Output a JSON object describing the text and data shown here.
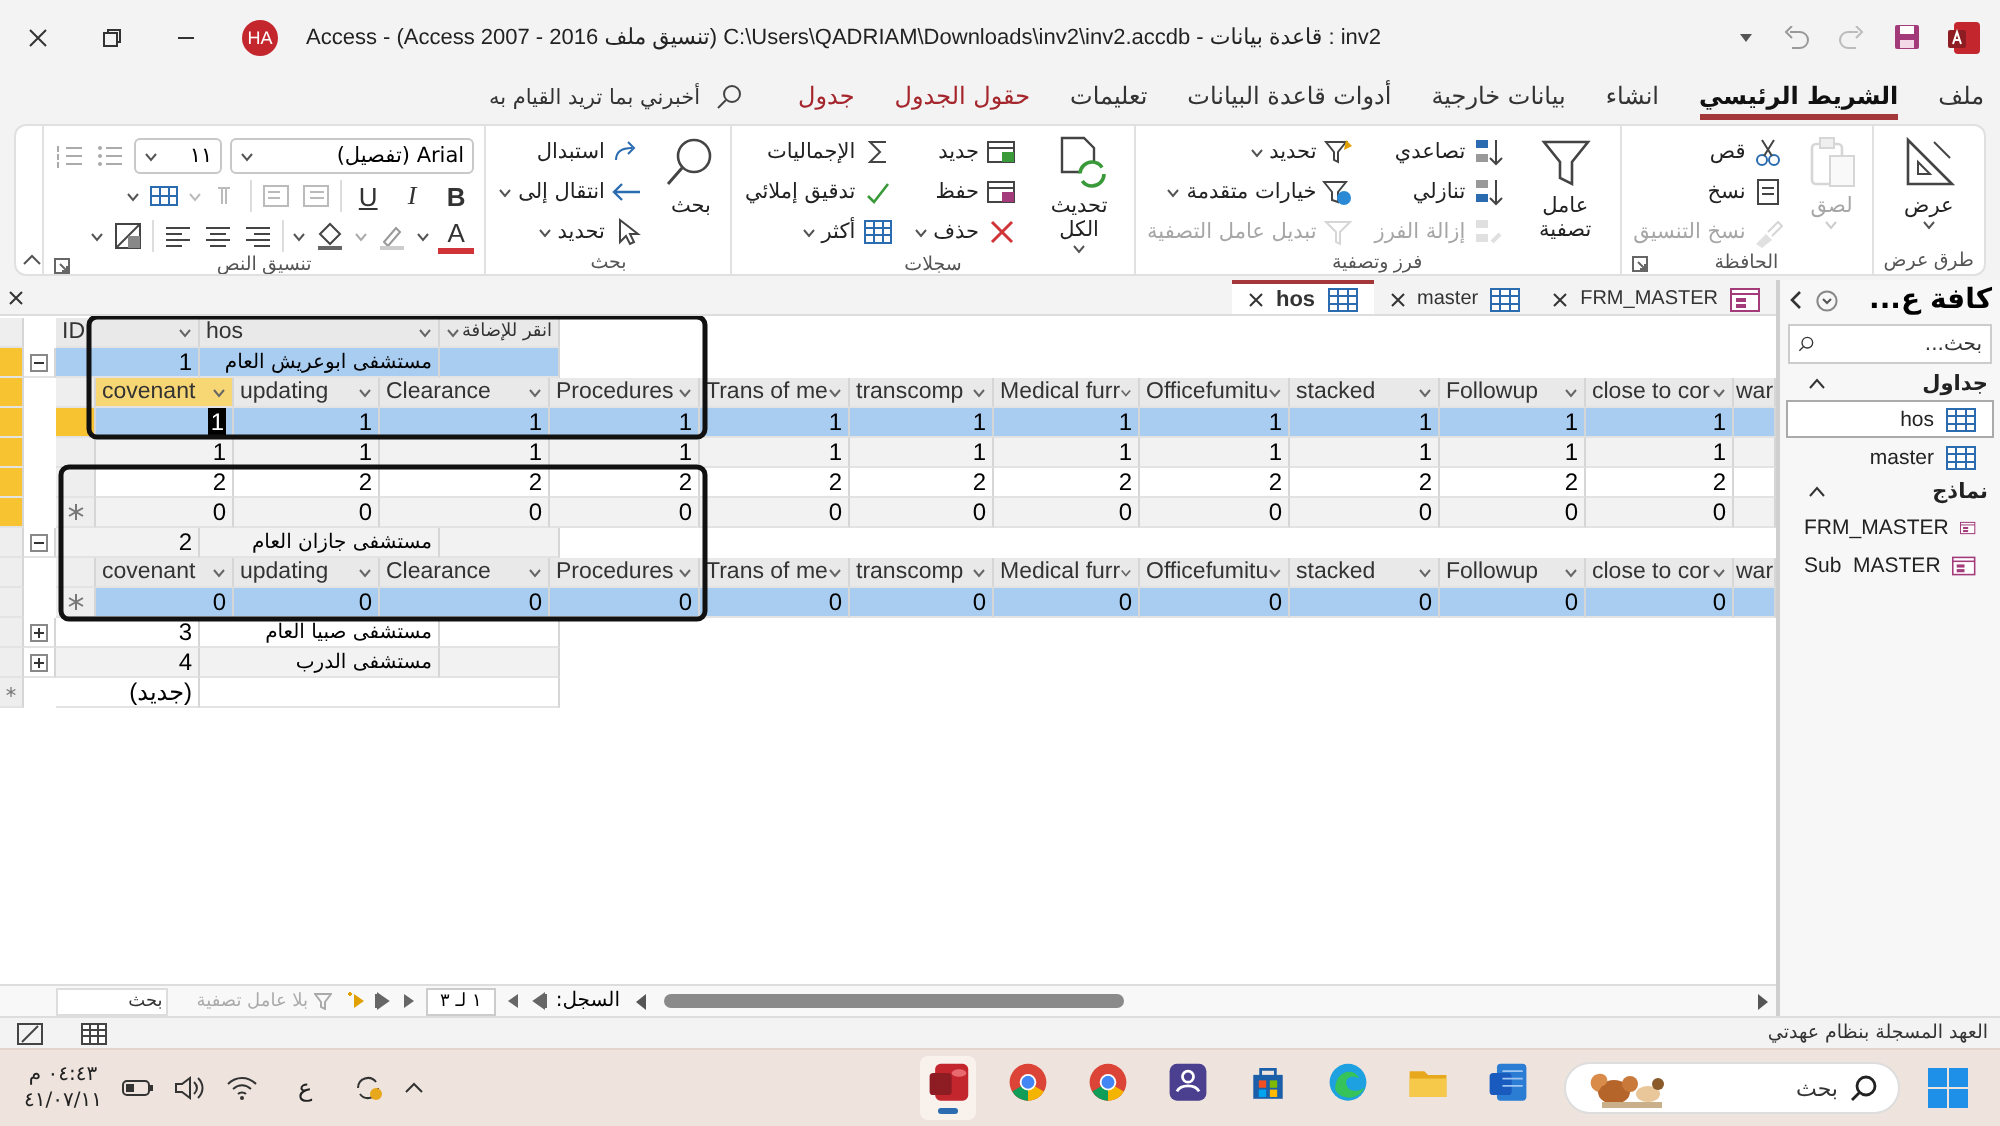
{
  "title_bar": {
    "title": "Access  -  (Access 2007 - 2016 تنسيق ملف) C:\\Users\\QADRIAM\\Downloads\\inv2\\inv2.accdb - قاعدة بيانات : inv2",
    "account": "HA"
  },
  "ribbon_tabs": [
    {
      "label": "ملف",
      "selected": false,
      "contextual": false
    },
    {
      "label": "الشريط الرئيسي",
      "selected": true,
      "contextual": false
    },
    {
      "label": "انشاء",
      "selected": false,
      "contextual": false
    },
    {
      "label": "بيانات خارجية",
      "selected": false,
      "contextual": false
    },
    {
      "label": "أدوات قاعدة البيانات",
      "selected": false,
      "contextual": false
    },
    {
      "label": "تعليمات",
      "selected": false,
      "contextual": false
    },
    {
      "label": "حقول الجدول",
      "selected": false,
      "contextual": true
    },
    {
      "label": "جدول",
      "selected": false,
      "contextual": true
    }
  ],
  "tell_me": {
    "placeholder": "أخبرني بما تريد القيام به"
  },
  "ribbon_groups": [
    {
      "kind": "commands",
      "label": "طرق عرض",
      "launcher": false,
      "items": [
        {
          "kind": "large",
          "label": "عرض",
          "disabled": false,
          "dropdown": true
        }
      ]
    },
    {
      "kind": "commands",
      "label": "الحافظة",
      "launcher": true,
      "items": [
        {
          "kind": "large",
          "label": "لصق",
          "disabled": true,
          "dropdown": true
        },
        {
          "kind": "column",
          "buttons": [
            {
              "label": "قص",
              "disabled": false,
              "dropdown": false
            },
            {
              "label": "نسخ",
              "disabled": false,
              "dropdown": false
            },
            {
              "label": "نسخ التنسيق",
              "disabled": true,
              "dropdown": false
            }
          ]
        }
      ]
    },
    {
      "kind": "commands",
      "label": "فرز وتصفية",
      "launcher": false,
      "items": [
        {
          "kind": "large",
          "label": "عامل تصفية",
          "disabled": false,
          "dropdown": false
        },
        {
          "kind": "column",
          "buttons": [
            {
              "label": "تصاعدي",
              "disabled": false,
              "dropdown": false
            },
            {
              "label": "تنازلي",
              "disabled": false,
              "dropdown": false
            },
            {
              "label": "إزالة الفرز",
              "disabled": true,
              "dropdown": false
            }
          ]
        },
        {
          "kind": "column",
          "buttons": [
            {
              "label": "تحديد",
              "disabled": false,
              "dropdown": true
            },
            {
              "label": "خيارات متقدمة",
              "disabled": false,
              "dropdown": true
            },
            {
              "label": "تبديل عامل التصفية",
              "disabled": true,
              "dropdown": false
            }
          ]
        }
      ]
    },
    {
      "kind": "commands",
      "label": "سجلات",
      "launcher": false,
      "items": [
        {
          "kind": "large",
          "label": "تحديث الكل",
          "disabled": false,
          "dropdown": true
        },
        {
          "kind": "column",
          "buttons": [
            {
              "label": "جديد",
              "disabled": false,
              "dropdown": false
            },
            {
              "label": "حفظ",
              "disabled": false,
              "dropdown": false
            },
            {
              "label": "حذف",
              "disabled": false,
              "dropdown": true
            }
          ]
        },
        {
          "kind": "column",
          "buttons": [
            {
              "label": "الإجماليات",
              "disabled": false,
              "dropdown": false
            },
            {
              "label": "تدقيق إملائي",
              "disabled": false,
              "dropdown": false
            },
            {
              "label": "أكثر",
              "disabled": false,
              "dropdown": true
            }
          ]
        }
      ]
    },
    {
      "kind": "commands",
      "label": "بحث",
      "launcher": false,
      "items": [
        {
          "kind": "large",
          "label": "بحث",
          "disabled": false,
          "dropdown": false
        },
        {
          "kind": "column",
          "buttons": [
            {
              "label": "استبدال",
              "disabled": false,
              "dropdown": false
            },
            {
              "label": "انتقال إلى",
              "disabled": false,
              "dropdown": true
            },
            {
              "label": "تحديد",
              "disabled": false,
              "dropdown": true
            }
          ]
        }
      ]
    },
    {
      "kind": "text_format",
      "label": "تنسيق النص",
      "launcher": true,
      "font": "Arial (تفصيل)",
      "size": "١١",
      "bold": "B",
      "italic": "I",
      "underline": "U",
      "font_color": "A"
    }
  ],
  "document_tabs": [
    {
      "label": "FRM_MASTER",
      "kind": "form",
      "selected": false
    },
    {
      "label": "master",
      "kind": "table",
      "selected": false
    },
    {
      "label": "hos",
      "kind": "table",
      "selected": true
    }
  ],
  "datasheet": {
    "columns": [
      "انقر للإضافة",
      "hos",
      "ID"
    ],
    "records": [
      {
        "id": "1",
        "hos": "مستشفى ابوعريش العام",
        "expanded": true,
        "selected": true,
        "sub_columns": [
          "war",
          "close to cor",
          "Followup",
          "stacked",
          "Officefumitu",
          "Medical furr",
          "transcomp",
          "Trans of me",
          "Procedures",
          "Clearance",
          "updating",
          "covenant"
        ],
        "sub_rows": [
          {
            "values": [
              "1",
              "1",
              "1",
              "1",
              "1",
              "1",
              "1",
              "1",
              "1",
              "1",
              "1"
            ],
            "selected": true,
            "focused": true,
            "new": false
          },
          {
            "values": [
              "1",
              "1",
              "1",
              "1",
              "1",
              "1",
              "1",
              "1",
              "1",
              "1",
              "1"
            ],
            "selected": false,
            "focused": false,
            "new": false
          },
          {
            "values": [
              "2",
              "2",
              "2",
              "2",
              "2",
              "2",
              "2",
              "2",
              "2",
              "2",
              "2"
            ],
            "selected": false,
            "focused": false,
            "new": false
          },
          {
            "values": [
              "0",
              "0",
              "0",
              "0",
              "0",
              "0",
              "0",
              "0",
              "0",
              "0",
              "0"
            ],
            "selected": false,
            "focused": false,
            "new": true
          }
        ]
      },
      {
        "id": "2",
        "hos": "مستشفى جازان العام",
        "expanded": true,
        "selected": false,
        "sub_columns": [
          "war",
          "close to cor",
          "Followup",
          "stacked",
          "Officefumitu",
          "Medical furr",
          "transcomp",
          "Trans of me",
          "Procedures",
          "Clearance",
          "updating",
          "covenant"
        ],
        "sub_rows": [
          {
            "values": [
              "0",
              "0",
              "0",
              "0",
              "0",
              "0",
              "0",
              "0",
              "0",
              "0",
              "0"
            ],
            "selected": true,
            "focused": false,
            "new": true
          }
        ]
      },
      {
        "id": "3",
        "hos": "مستشفى صبيا العام",
        "expanded": false,
        "selected": false
      },
      {
        "id": "4",
        "hos": "مستشفى الدرب",
        "expanded": false,
        "selected": false
      }
    ],
    "new_record": "(جديد)"
  },
  "annotations": [
    {
      "kind": "outline"
    },
    {
      "kind": "outline"
    }
  ],
  "record_navigator": {
    "label": "السجل:",
    "position": "١ لـ ٣",
    "filter": "بلا عامل تصفية",
    "search": {
      "placeholder": "بحث"
    }
  },
  "nav_pane": {
    "title": "كافة ع...",
    "search": {
      "placeholder": "بحث..."
    },
    "groups": [
      {
        "label": "جداول",
        "expanded": true,
        "items": [
          {
            "label": "hos",
            "kind": "table",
            "selected": true
          },
          {
            "label": "master",
            "kind": "table",
            "selected": false
          }
        ]
      },
      {
        "label": "نماذج",
        "expanded": true,
        "items": [
          {
            "label": "FRM_MASTER",
            "kind": "form",
            "selected": false
          },
          {
            "label": "Sub  MASTER",
            "kind": "form",
            "selected": false
          }
        ]
      }
    ]
  },
  "status_bar": {
    "message": "العهد المسجلة بنظام عهدتي"
  },
  "taskbar": {
    "time": "٠٤:٤٣ م",
    "date": "٤١/٠٧/١١",
    "language": "ع",
    "search": {
      "placeholder": "بحث"
    },
    "apps": [
      {
        "kind": "database",
        "active": true
      },
      {
        "kind": "browser",
        "active": false
      },
      {
        "kind": "browser",
        "active": false
      },
      {
        "kind": "cloud",
        "active": false
      },
      {
        "kind": "store",
        "active": false
      },
      {
        "kind": "web",
        "active": false
      },
      {
        "kind": "folder",
        "active": false
      },
      {
        "kind": "writer",
        "active": false
      }
    ]
  }
}
